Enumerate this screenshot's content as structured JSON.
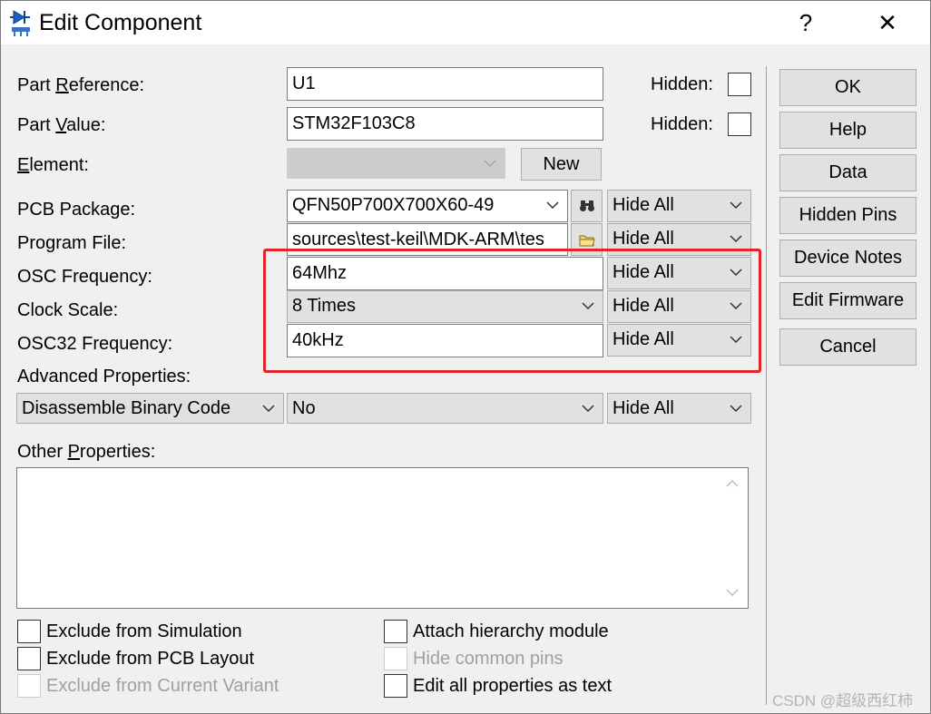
{
  "window": {
    "title": "Edit Component",
    "help_glyph": "?",
    "close_glyph": "✕"
  },
  "fields": {
    "part_reference": {
      "label_pre": "Part ",
      "label_ul": "R",
      "label_post": "eference:",
      "value": "U1",
      "hidden_label": "Hidden:"
    },
    "part_value": {
      "label_pre": "Part ",
      "label_ul": "V",
      "label_post": "alue:",
      "value": "STM32F103C8",
      "hidden_label": "Hidden:"
    },
    "element": {
      "label_pre": "",
      "label_ul": "E",
      "label_post": "lement:",
      "value": "",
      "new_button": "New"
    },
    "pcb_package": {
      "label": "PCB Package:",
      "value": "QFN50P700X700X60-49",
      "visibility": "Hide All"
    },
    "program_file": {
      "label": "Program File:",
      "value": "sources\\test-keil\\MDK-ARM\\tes",
      "visibility": "Hide All"
    },
    "osc_frequency": {
      "label": "OSC Frequency:",
      "value": "64Mhz",
      "visibility": "Hide All"
    },
    "clock_scale": {
      "label": "Clock Scale:",
      "value": "8 Times",
      "visibility": "Hide All"
    },
    "osc32_frequency": {
      "label": "OSC32 Frequency:",
      "value": "40kHz",
      "visibility": "Hide All"
    }
  },
  "advanced": {
    "label": "Advanced Properties:",
    "property": "Disassemble Binary Code",
    "value": "No",
    "visibility": "Hide All"
  },
  "other": {
    "label_pre": "Other ",
    "label_ul": "P",
    "label_post": "roperties:",
    "text": ""
  },
  "checkboxes": {
    "exclude_simulation": "Exclude from Simulation",
    "exclude_pcb": "Exclude from PCB Layout",
    "exclude_variant": "Exclude from Current Variant",
    "attach_hierarchy": "Attach hierarchy module",
    "hide_common_pins": "Hide common pins",
    "edit_as_text": "Edit all properties as text"
  },
  "buttons": {
    "ok": "OK",
    "help": "Help",
    "data": "Data",
    "hidden_pins": "Hidden Pins",
    "device_notes": "Device Notes",
    "edit_firmware": "Edit Firmware",
    "cancel": "Cancel"
  },
  "colors": {
    "highlight": "#e0262d",
    "dialog_bg": "#f0f0f0"
  },
  "watermark": "CSDN @超级西红柿"
}
